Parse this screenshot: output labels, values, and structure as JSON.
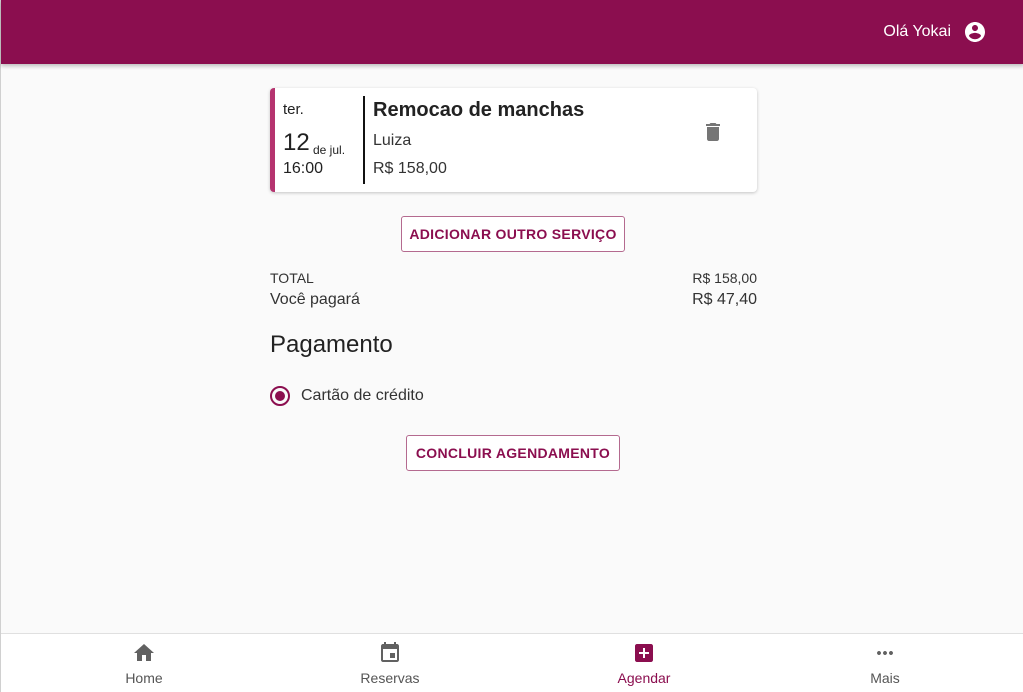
{
  "header": {
    "greeting": "Olá Yokai",
    "account_icon": "account-circle-icon"
  },
  "appointment": {
    "weekday": "ter.",
    "day": "12",
    "month": "de jul.",
    "time": "16:00",
    "service": "Remocao de manchas",
    "professional": "Luiza",
    "price": "R$ 158,00",
    "delete_icon": "trash-icon"
  },
  "actions": {
    "add_service": "ADICIONAR OUTRO SERVIÇO",
    "finish": "CONCLUIR AGENDAMENTO"
  },
  "summary": {
    "total_label": "TOTAL",
    "total_value": "R$ 158,00",
    "pay_label": "Você pagará",
    "pay_value": "R$ 47,40"
  },
  "payment": {
    "title": "Pagamento",
    "option_label": "Cartão de crédito",
    "selected": true
  },
  "nav": {
    "items": [
      {
        "label": "Home",
        "icon": "home-icon",
        "active": false
      },
      {
        "label": "Reservas",
        "icon": "calendar-icon",
        "active": false
      },
      {
        "label": "Agendar",
        "icon": "add-box-icon",
        "active": true
      },
      {
        "label": "Mais",
        "icon": "more-horiz-icon",
        "active": false
      }
    ]
  },
  "colors": {
    "primary": "#8b0e4f",
    "card_accent": "#b5336f",
    "background": "#fafafa"
  }
}
